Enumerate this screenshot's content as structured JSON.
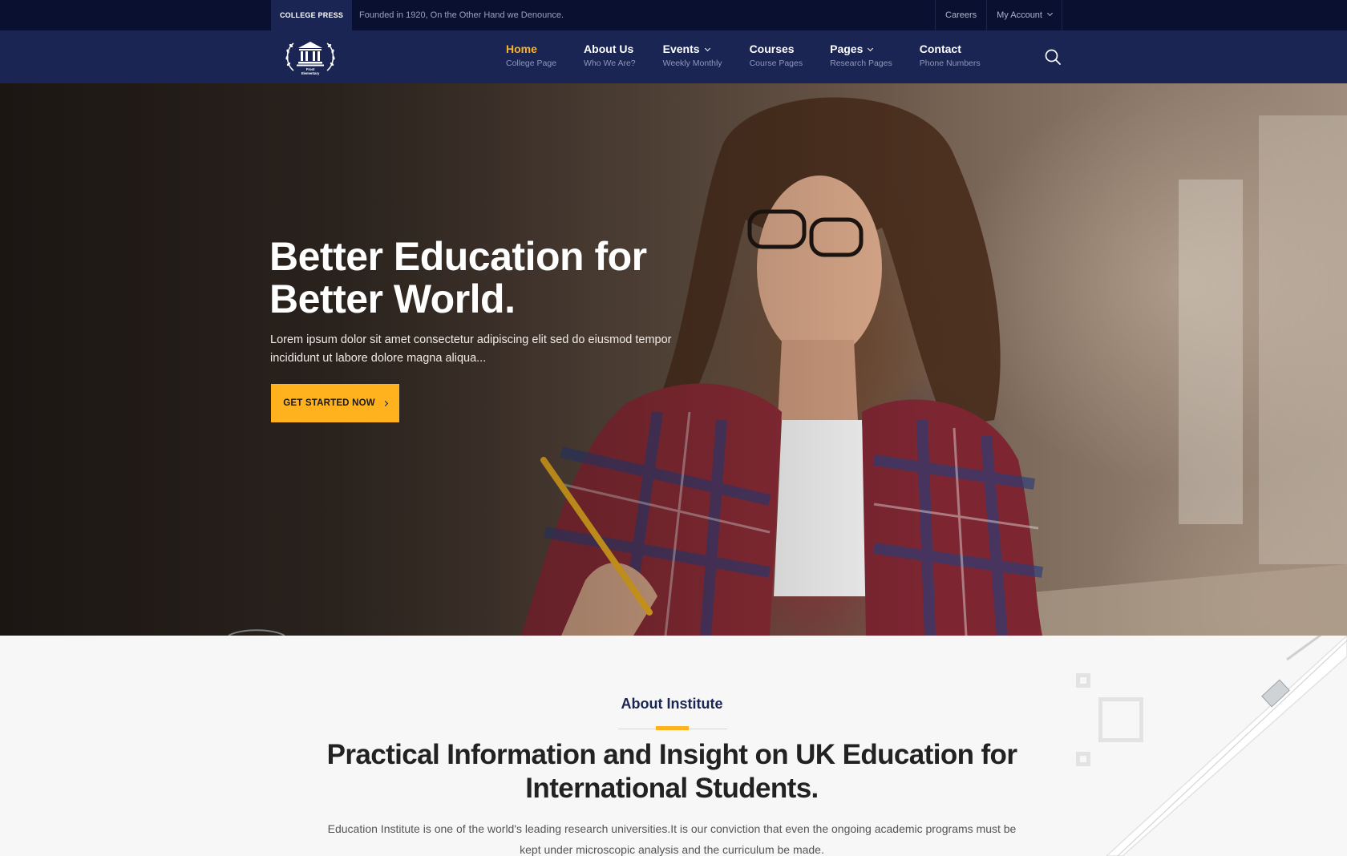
{
  "topbar": {
    "badge": "COLLEGE PRESS",
    "tagline": "Founded in 1920, On the Other Hand we Denounce.",
    "links": {
      "careers": "Careers",
      "account": "My Account"
    }
  },
  "logo": {
    "text": "Frost Elementary"
  },
  "nav": {
    "items": [
      {
        "label": "Home",
        "sub": "College Page",
        "active": true
      },
      {
        "label": "About Us",
        "sub": "Who We Are?"
      },
      {
        "label": "Events",
        "sub": "Weekly Monthly",
        "dropdown": true
      },
      {
        "label": "Courses",
        "sub": "Course Pages"
      },
      {
        "label": "Pages",
        "sub": "Research Pages",
        "dropdown": true
      },
      {
        "label": "Contact",
        "sub": "Phone Numbers"
      }
    ]
  },
  "hero": {
    "title_line1": "Better Education for",
    "title_line2": "Better World.",
    "text": "Lorem ipsum dolor sit amet consectetur adipiscing elit sed do eiusmod tempor incididunt ut labore dolore magna aliqua...",
    "cta": "GET STARTED NOW"
  },
  "about": {
    "kicker": "About Institute",
    "heading": "Practical Information and Insight on UK Education for International Students.",
    "description": "Education Institute is one of the world's leading research universities.It is our conviction that even the ongoing academic programs must be kept under microscopic analysis and the curriculum be made."
  },
  "colors": {
    "accent": "#ffb21e",
    "navy": "#1a2553",
    "topbar": "#0a1130"
  }
}
